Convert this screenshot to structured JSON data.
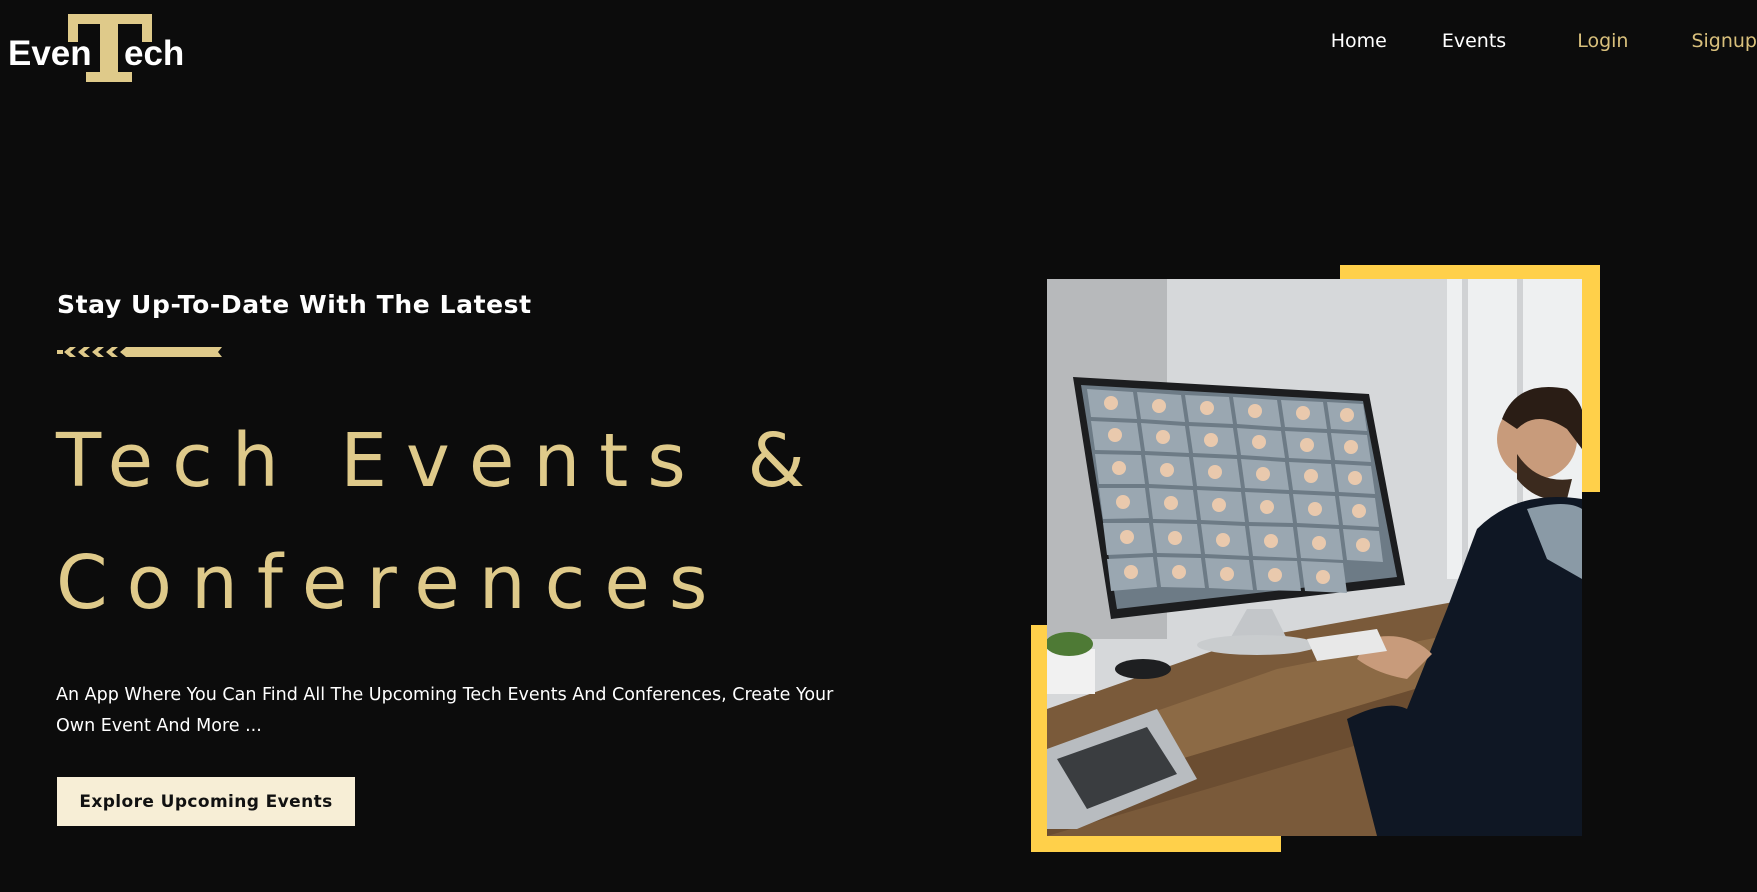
{
  "brand": {
    "name": "EvenTech",
    "accent_color": "#d9c07c"
  },
  "nav": {
    "items": [
      {
        "label": "Home"
      },
      {
        "label": "Events"
      },
      {
        "label": "Login"
      },
      {
        "label": "Signup"
      }
    ]
  },
  "hero": {
    "kicker": "Stay Up-To-Date With The Latest",
    "headline_line1": "Tech Events &",
    "headline_line2": "Conferences",
    "description": "An App Where You Can Find All The Upcoming Tech Events And Conferences, Create Your Own Event And More ...",
    "cta_label": "Explore Upcoming Events",
    "headline_color": "#dfca8a",
    "frame_color": "#ffd04a",
    "cta_background": "#f7eed6"
  },
  "icons": {
    "divider": "chevron-divider-icon",
    "photo": "video-conference-photo"
  }
}
